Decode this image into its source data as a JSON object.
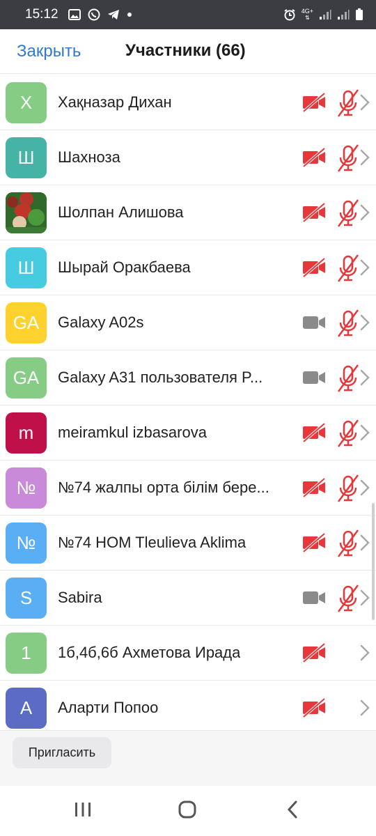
{
  "status": {
    "time": "15:12",
    "network": "4G+"
  },
  "header": {
    "close_label": "Закрыть",
    "title": "Участники (66)"
  },
  "participants": [
    {
      "name": "Хақназар Дихан",
      "initials": "Х",
      "color": "#86cc84",
      "video": "off",
      "mic": "muted"
    },
    {
      "name": "Шахноза",
      "initials": "Ш",
      "color": "#45b4a6",
      "video": "off",
      "mic": "muted"
    },
    {
      "name": "Шолпан Алишова",
      "initials": "",
      "color": "#7a3a2a",
      "video": "off",
      "mic": "muted",
      "photo": true
    },
    {
      "name": "Шырай Оракбаева",
      "initials": "Ш",
      "color": "#46cbe1",
      "video": "off",
      "mic": "muted"
    },
    {
      "name": "Galaxy A02s",
      "initials": "GA",
      "color": "#fdd22f",
      "video": "on",
      "mic": "muted"
    },
    {
      "name": "Galaxy A31 пользователя P...",
      "initials": "GA",
      "color": "#86cc84",
      "video": "on",
      "mic": "muted"
    },
    {
      "name": "meiramkul izbasarova",
      "initials": "m",
      "color": "#c0104a",
      "video": "off",
      "mic": "muted"
    },
    {
      "name": "№74 жалпы орта білім бере...",
      "initials": "№",
      "color": "#c98ad9",
      "video": "off",
      "mic": "muted"
    },
    {
      "name": "№74 HOM Tleulieva Aklima",
      "initials": "№",
      "color": "#5aaef3",
      "video": "off",
      "mic": "muted"
    },
    {
      "name": "Sabira",
      "initials": "S",
      "color": "#5aaef3",
      "video": "on",
      "mic": "muted"
    },
    {
      "name": "1б,4б,6б Ахметова Ирада",
      "initials": "1",
      "color": "#86cc84",
      "video": "off",
      "mic": "none"
    },
    {
      "name": "Аларти Попоо",
      "initials": "A",
      "color": "#5c6bc4",
      "video": "off",
      "mic": "none"
    }
  ],
  "footer": {
    "invite_label": "Пригласить"
  },
  "colors": {
    "accent": "#2d7ad6",
    "muted_red": "#e8373a",
    "video_gray": "#8a8a8a"
  }
}
